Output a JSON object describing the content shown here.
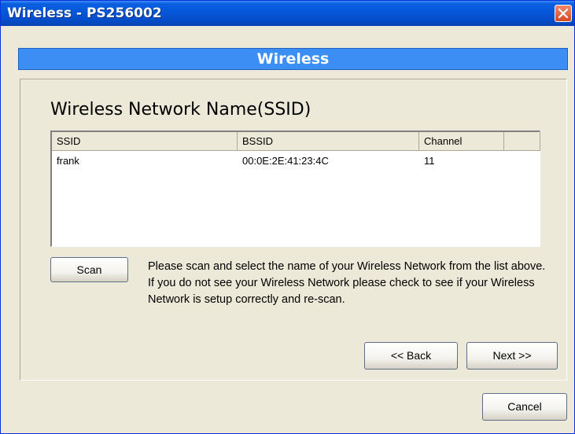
{
  "window": {
    "title": "Wireless - PS256002"
  },
  "banner": {
    "title": "Wireless"
  },
  "section": {
    "title": "Wireless Network Name(SSID)"
  },
  "table": {
    "columns": [
      "SSID",
      "BSSID",
      "Channel",
      ""
    ],
    "rows": [
      {
        "ssid": "frank",
        "bssid": "00:0E:2E:41:23:4C",
        "channel": "11"
      }
    ]
  },
  "scan": {
    "label": "Scan"
  },
  "info": {
    "line1": "Please scan and select the name of your Wireless Network from the list above.",
    "line2": "If you do not see your Wireless Network please check to see if your Wireless Network is setup correctly and re-scan."
  },
  "nav": {
    "back_label": "<< Back",
    "next_label": "Next >>",
    "cancel_label": "Cancel"
  },
  "colors": {
    "titlebar": "#0556d6",
    "banner": "#3b8ef4",
    "dialog_bg": "#ece9d8",
    "close_button": "#d34a22"
  },
  "icons": {
    "close": "close-icon"
  }
}
